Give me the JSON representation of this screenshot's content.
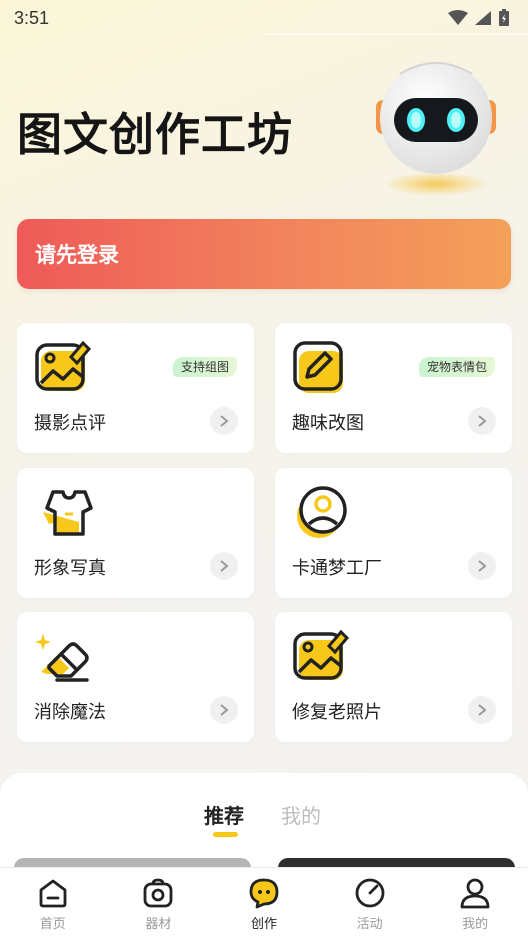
{
  "status_bar": {
    "time": "3:51"
  },
  "header": {
    "title": "图文创作工坊"
  },
  "login_banner": {
    "label": "请先登录"
  },
  "tools": [
    {
      "label": "摄影点评",
      "tag": "支持组图",
      "icon": "photo-edit-icon"
    },
    {
      "label": "趣味改图",
      "tag": "宠物表情包",
      "icon": "pencil-square-icon"
    },
    {
      "label": "形象写真",
      "tag": "",
      "icon": "tshirt-icon"
    },
    {
      "label": "卡通梦工厂",
      "tag": "",
      "icon": "avatar-circle-icon"
    },
    {
      "label": "消除魔法",
      "tag": "",
      "icon": "eraser-icon"
    },
    {
      "label": "修复老照片",
      "tag": "",
      "icon": "photo-restore-icon"
    }
  ],
  "feed_tabs": [
    {
      "label": "推荐",
      "active": true
    },
    {
      "label": "我的",
      "active": false
    }
  ],
  "bottom_nav": [
    {
      "label": "首页",
      "icon": "home-icon",
      "active": false
    },
    {
      "label": "器材",
      "icon": "camera-bag-icon",
      "active": false
    },
    {
      "label": "创作",
      "icon": "chat-bubble-icon",
      "active": true
    },
    {
      "label": "活动",
      "icon": "gauge-icon",
      "active": false
    },
    {
      "label": "我的",
      "icon": "user-icon",
      "active": false
    }
  ],
  "colors": {
    "accent_yellow": "#f7c81a",
    "banner_start": "#ee5a58",
    "banner_end": "#f4a059",
    "tag_green": "#c9f3cf"
  }
}
